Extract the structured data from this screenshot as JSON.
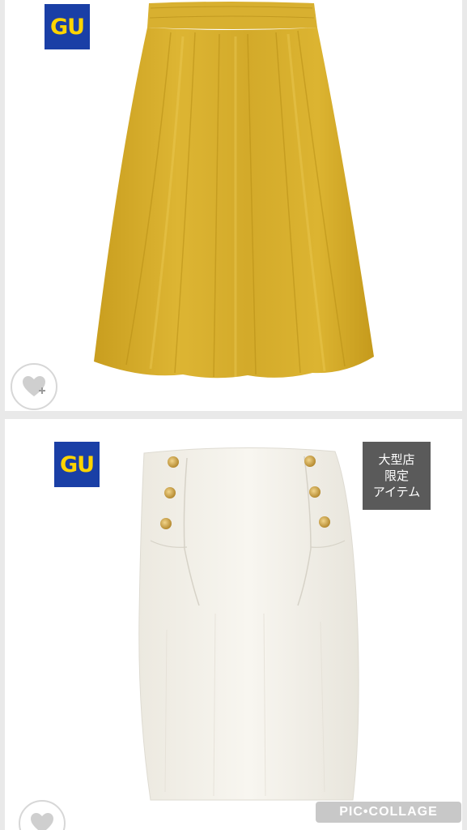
{
  "panels": [
    {
      "brand_logo_text": "GU",
      "product": "yellow-gathered-midi-skirt",
      "favorite_icon": "heart-plus-icon",
      "colors": {
        "skirt": "#d9b12b",
        "logo_bg": "#1a3fa6",
        "logo_text": "#ffd400"
      }
    },
    {
      "brand_logo_text": "GU",
      "product": "white-sailor-button-pencil-skirt",
      "favorite_icon": "heart-plus-icon",
      "badge_lines": [
        "大型店",
        "限定",
        "アイテム"
      ],
      "colors": {
        "skirt": "#f5f3ec",
        "buttons": "#c9a24a",
        "badge_bg": "#5a5a5a"
      }
    }
  ],
  "watermark": {
    "text": "PIC•COLLAGE"
  }
}
